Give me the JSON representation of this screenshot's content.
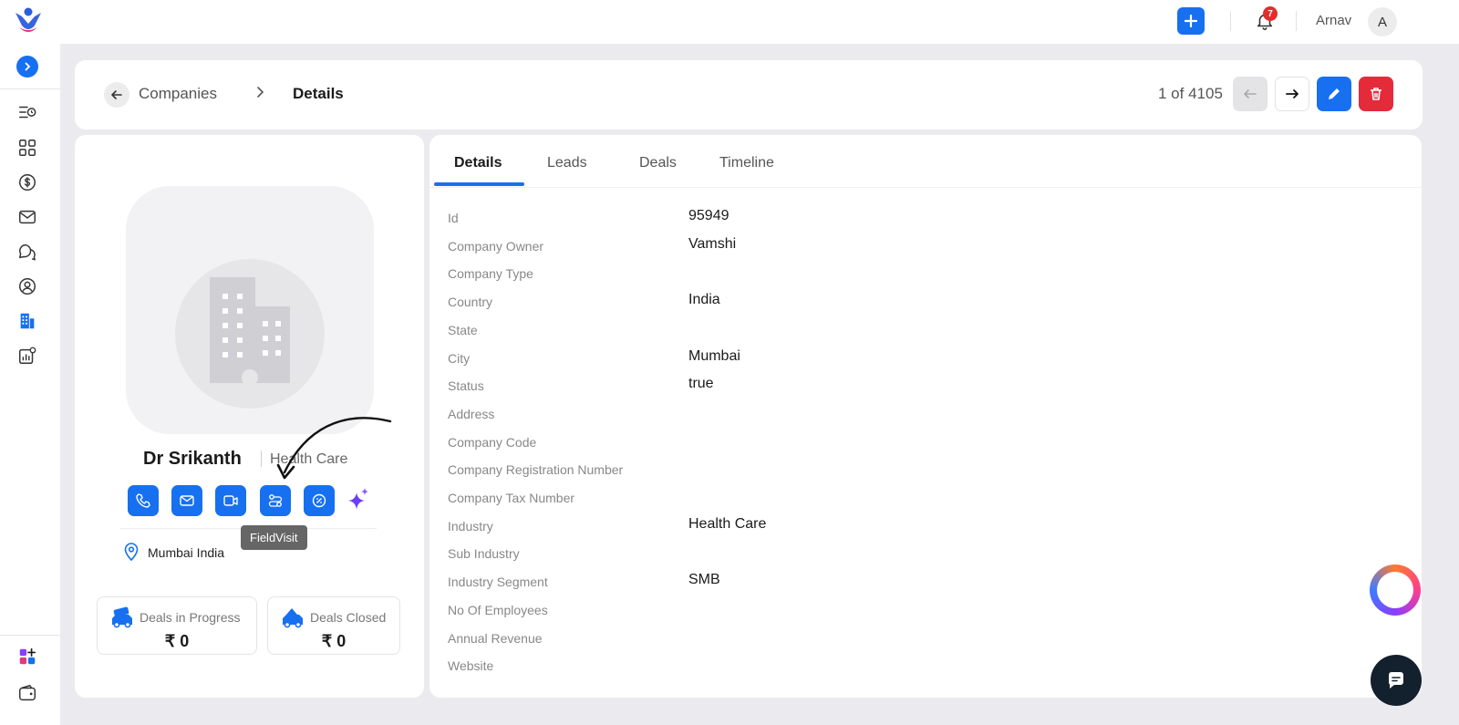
{
  "topbar": {
    "notifications_count": "7",
    "user_name": "Arnav",
    "avatar_initial": "A"
  },
  "header": {
    "breadcrumb_parent": "Companies",
    "breadcrumb_current": "Details",
    "pager": "1 of 4105"
  },
  "company": {
    "name": "Dr Srikanth",
    "industry": "Health Care",
    "location": "Mumbai India",
    "tooltip": "FieldVisit",
    "stats": [
      {
        "label": "Deals in Progress",
        "value": "₹ 0"
      },
      {
        "label": "Deals Closed",
        "value": "₹ 0"
      }
    ]
  },
  "tabs": [
    "Details",
    "Leads",
    "Deals",
    "Timeline"
  ],
  "fields": [
    {
      "label": "Id",
      "value": "95949"
    },
    {
      "label": "Company Owner",
      "value": "Vamshi"
    },
    {
      "label": "Company Type",
      "value": ""
    },
    {
      "label": "Country",
      "value": "India"
    },
    {
      "label": "State",
      "value": ""
    },
    {
      "label": "City",
      "value": "Mumbai"
    },
    {
      "label": "Status",
      "value": "true"
    },
    {
      "label": "Address",
      "value": ""
    },
    {
      "label": "Company Code",
      "value": ""
    },
    {
      "label": "Company Registration Number",
      "value": ""
    },
    {
      "label": "Company Tax Number",
      "value": ""
    },
    {
      "label": "Industry",
      "value": "Health Care"
    },
    {
      "label": "Sub Industry",
      "value": ""
    },
    {
      "label": "Industry Segment",
      "value": "SMB"
    },
    {
      "label": "No Of Employees",
      "value": ""
    },
    {
      "label": "Annual Revenue",
      "value": ""
    },
    {
      "label": "Website",
      "value": ""
    }
  ],
  "colors": {
    "primary": "#1670f0",
    "danger": "#e52b3a",
    "badge": "#e52b2b"
  }
}
